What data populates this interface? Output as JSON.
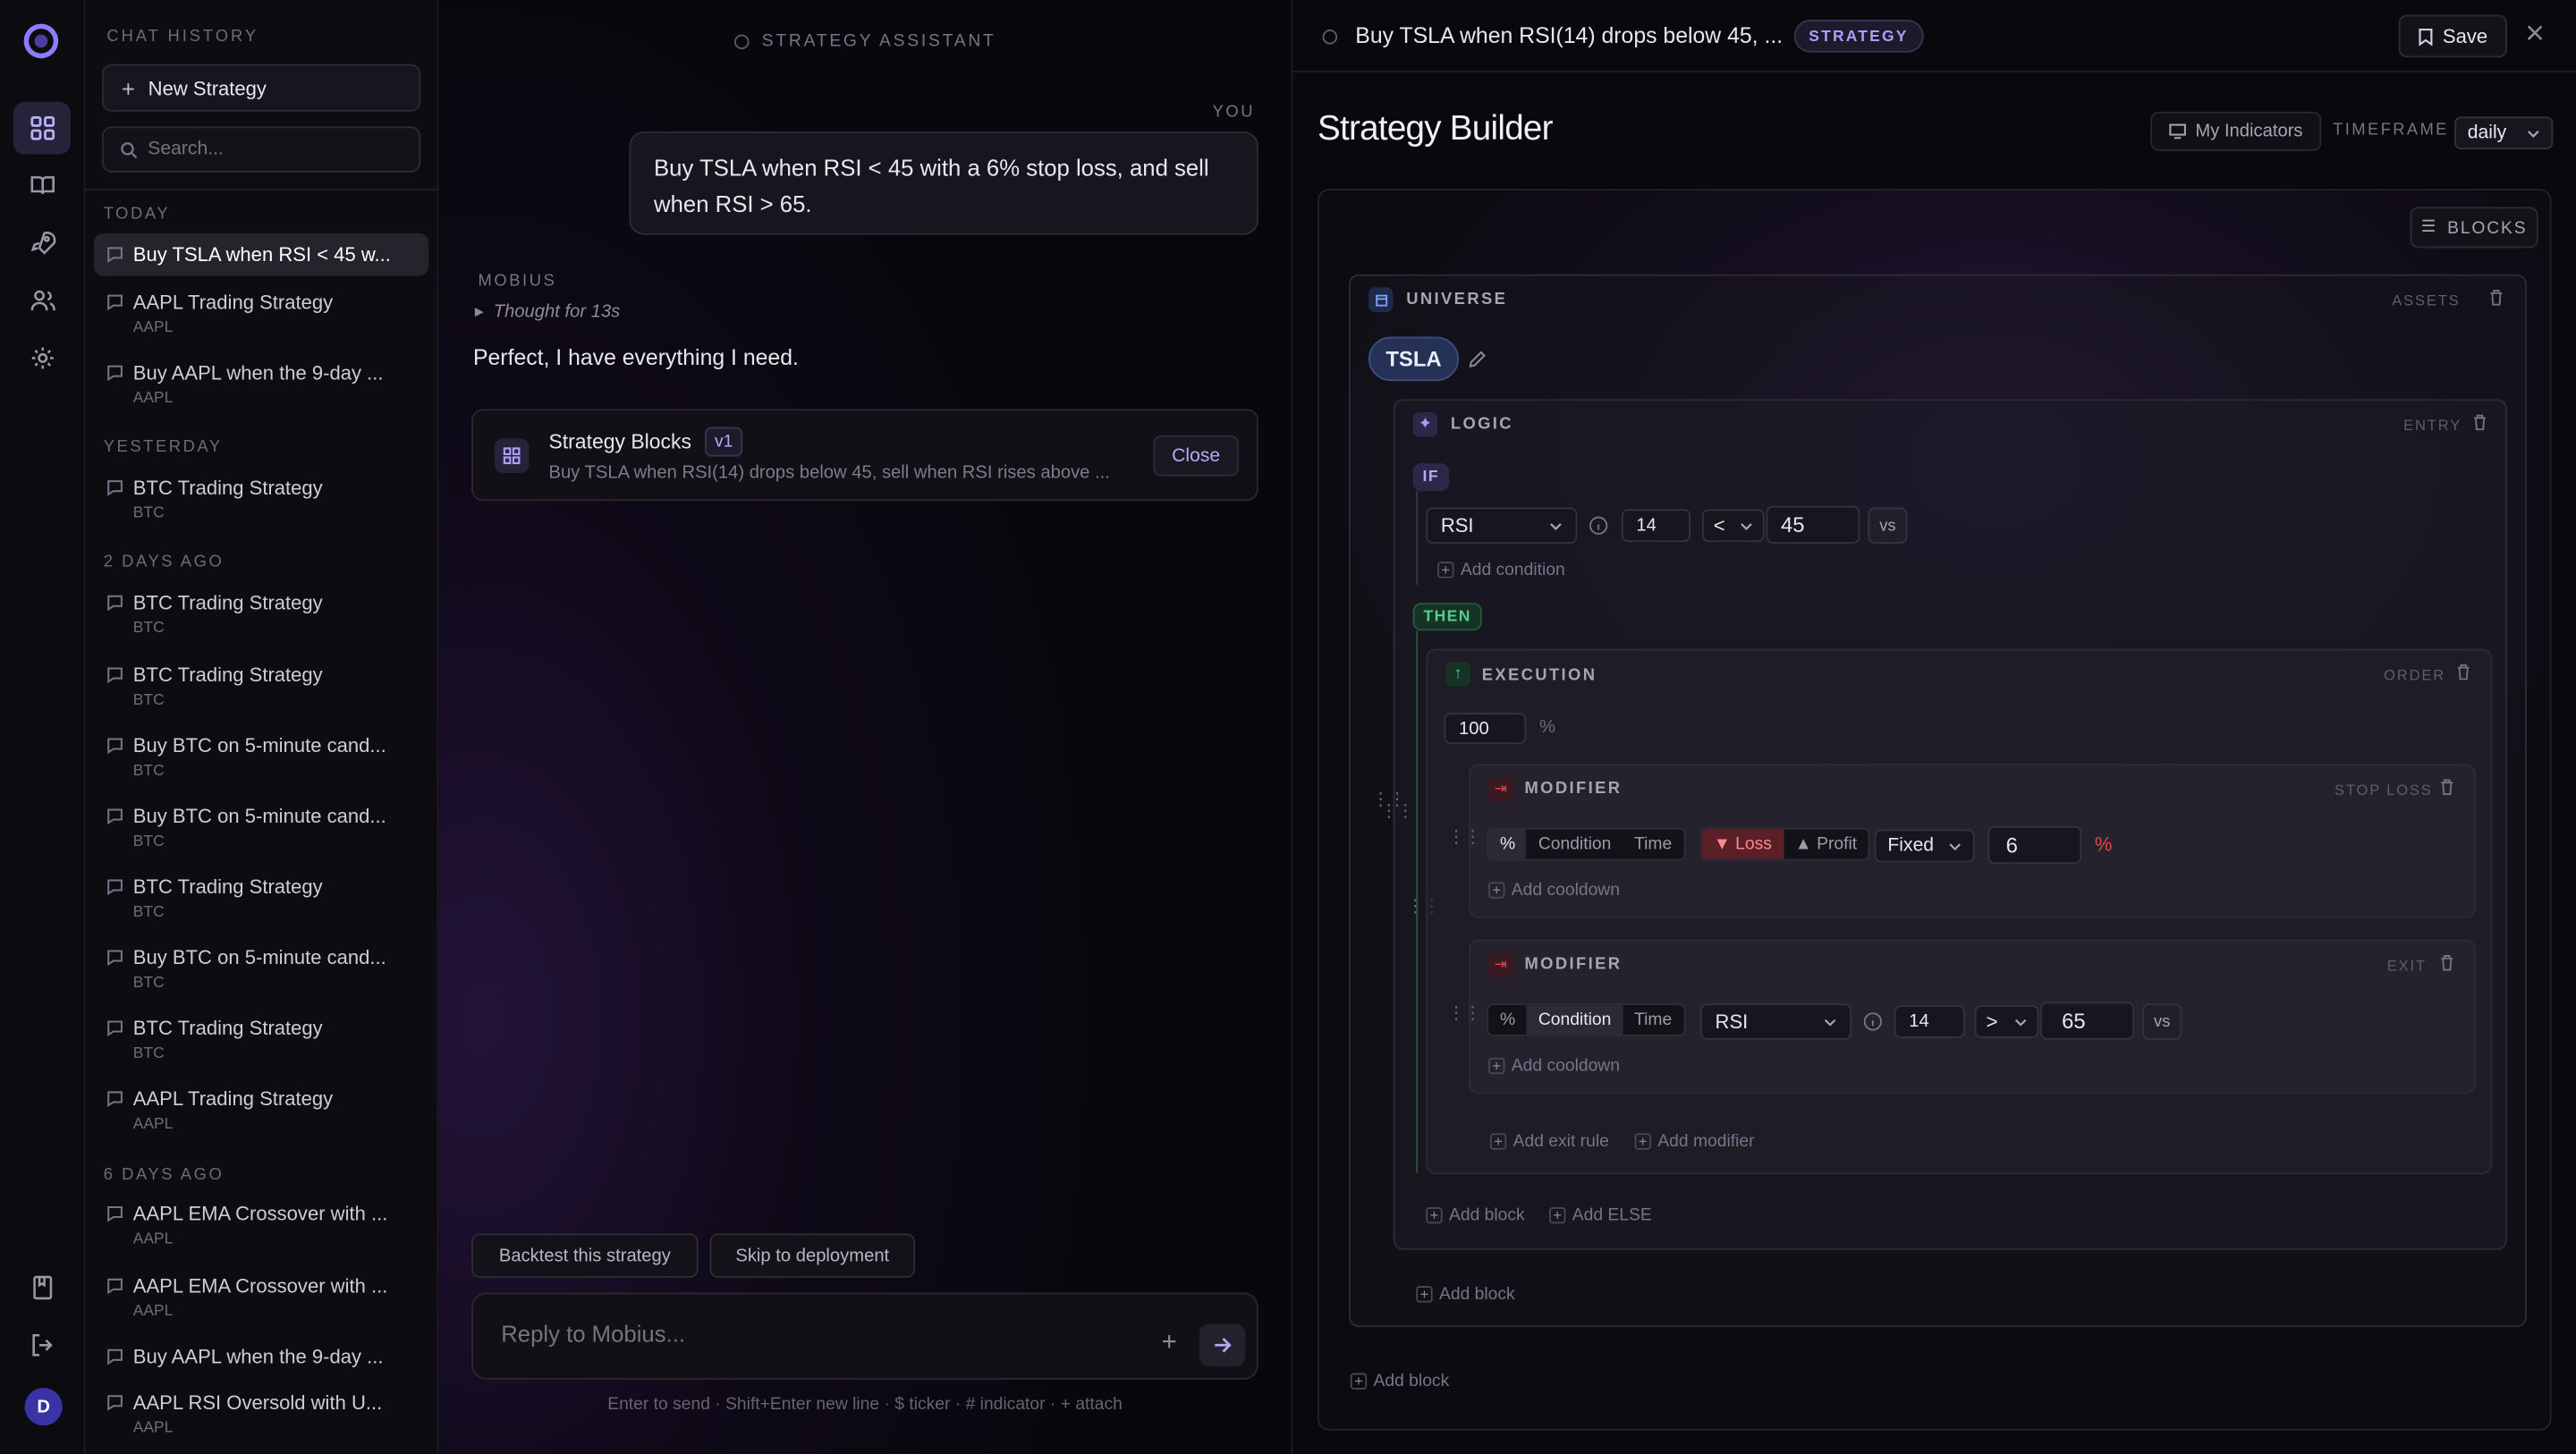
{
  "sidebar": {
    "title": "CHAT HISTORY",
    "new_label": "New Strategy",
    "search_placeholder": "Search...",
    "sections": {
      "today": "TODAY",
      "yesterday": "YESTERDAY",
      "two_days": "2 DAYS AGO",
      "six_days": "6 DAYS AGO"
    },
    "items": [
      {
        "t": "Buy TSLA when RSI < 45 w...",
        "s": ""
      },
      {
        "t": "AAPL Trading Strategy",
        "s": "AAPL"
      },
      {
        "t": "Buy AAPL when the 9-day ...",
        "s": "AAPL"
      },
      {
        "t": "BTC Trading Strategy",
        "s": "BTC"
      },
      {
        "t": "BTC Trading Strategy",
        "s": "BTC"
      },
      {
        "t": "BTC Trading Strategy",
        "s": "BTC"
      },
      {
        "t": "Buy BTC on 5-minute cand...",
        "s": "BTC"
      },
      {
        "t": "Buy BTC on 5-minute cand...",
        "s": "BTC"
      },
      {
        "t": "BTC Trading Strategy",
        "s": "BTC"
      },
      {
        "t": "Buy BTC on 5-minute cand...",
        "s": "BTC"
      },
      {
        "t": "BTC Trading Strategy",
        "s": "BTC"
      },
      {
        "t": "AAPL Trading Strategy",
        "s": "AAPL"
      },
      {
        "t": "AAPL EMA Crossover with ...",
        "s": "AAPL"
      },
      {
        "t": "AAPL EMA Crossover with ...",
        "s": "AAPL"
      },
      {
        "t": "Buy AAPL when the 9-day ...",
        "s": ""
      },
      {
        "t": "AAPL RSI Oversold with U...",
        "s": "AAPL"
      }
    ],
    "avatar": "D"
  },
  "chat": {
    "header": "STRATEGY ASSISTANT",
    "you_label": "YOU",
    "user_msg": "Buy TSLA when RSI < 45 with a 6% stop loss, and sell when RSI > 65.",
    "bot_label": "MOBIUS",
    "thought": "Thought for 13s",
    "reply": "Perfect, I have everything I need.",
    "card_title": "Strategy Blocks",
    "card_version": "v1",
    "card_desc": "Buy TSLA when RSI(14) drops below 45, sell when RSI rises above ...",
    "card_close": "Close",
    "action1": "Backtest this strategy",
    "action2": "Skip to deployment",
    "input_placeholder": "Reply to Mobius...",
    "hint": "Enter to send · Shift+Enter new line · $ ticker · # indicator · + attach"
  },
  "builder": {
    "top_title": "Buy TSLA when RSI(14) drops below 45, ...",
    "top_badge": "STRATEGY",
    "save": "Save",
    "title": "Strategy Builder",
    "my_indicators": "My Indicators",
    "timeframe_label": "TIMEFRAME",
    "timeframe": "daily",
    "blocks": "BLOCKS",
    "universe": {
      "label": "UNIVERSE",
      "tag": "ASSETS",
      "ticker": "TSLA"
    },
    "logic": {
      "label": "LOGIC",
      "tag": "ENTRY",
      "if": "IF",
      "then": "THEN",
      "indicator": "RSI",
      "period": "14",
      "op": "<",
      "value": "45",
      "vs": "vs",
      "add_condition": "Add condition"
    },
    "execution": {
      "label": "EXECUTION",
      "tag": "ORDER",
      "amount": "100",
      "unit": "%"
    },
    "stop": {
      "label": "MODIFIER",
      "tag": "STOP LOSS",
      "seg": [
        "%",
        "Condition",
        "Time"
      ],
      "loss": "▼ Loss",
      "profit": "▲ Profit",
      "mode": "Fixed",
      "value": "6",
      "unit": "%",
      "cooldown": "Add cooldown"
    },
    "exit": {
      "label": "MODIFIER",
      "tag": "EXIT",
      "seg": [
        "%",
        "Condition",
        "Time"
      ],
      "indicator": "RSI",
      "period": "14",
      "op": ">",
      "value": "65",
      "vs": "vs",
      "cooldown": "Add cooldown"
    },
    "add_exit_rule": "Add exit rule",
    "add_modifier": "Add modifier",
    "add_block": "Add block",
    "add_else": "Add ELSE"
  },
  "colors": {
    "accent": "#8b7dff",
    "bg": "#07060a",
    "loss": "#e0474c",
    "then": "#3fbf7f"
  }
}
